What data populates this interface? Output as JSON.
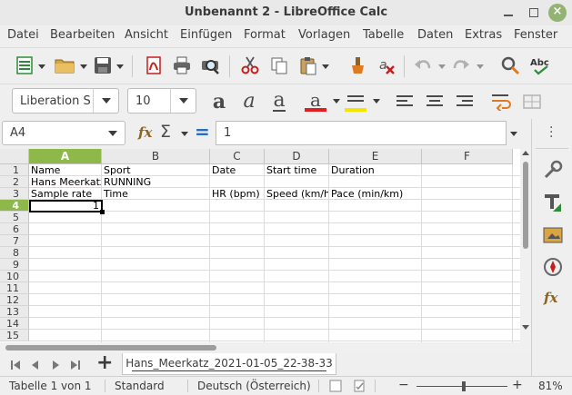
{
  "window": {
    "title": "Unbenannt 2 - LibreOffice Calc",
    "close_glyph": "×"
  },
  "menu": [
    "Datei",
    "Bearbeiten",
    "Ansicht",
    "Einfügen",
    "Format",
    "Vorlagen",
    "Tabelle",
    "Daten",
    "Extras",
    "Fenster"
  ],
  "toolbar": {
    "font_name": "Liberation S",
    "font_size": "10",
    "icons": [
      "new-spreadsheet-icon",
      "open-folder-icon",
      "save-icon",
      "export-pdf-icon",
      "print-icon",
      "print-preview-icon",
      "cut-icon",
      "copy-icon",
      "paste-icon",
      "clone-formatting-icon",
      "clear-formatting-icon",
      "undo-icon",
      "redo-icon",
      "find-replace-icon",
      "spelling-icon"
    ],
    "format_letters": {
      "bold": "a",
      "italic": "a",
      "underline": "a",
      "font_color": "a"
    },
    "font_color": "#e02020",
    "highlight_color": "#f5e400"
  },
  "formula_bar": {
    "name_box": "A4",
    "fx": "fx",
    "sigma": "Σ",
    "equals": "=",
    "content": "1"
  },
  "grid": {
    "columns": [
      "A",
      "B",
      "C",
      "D",
      "E",
      "F"
    ],
    "selected_column": "A",
    "rows": [
      "1",
      "2",
      "3",
      "4",
      "5",
      "6",
      "7",
      "8",
      "9",
      "10",
      "11",
      "12",
      "13",
      "14",
      "15"
    ],
    "selected_row": "4",
    "cells": {
      "A1": "Name",
      "B1": "Sport",
      "C1": "Date",
      "D1": "Start time",
      "E1": "Duration",
      "A2": "Hans Meerkatz",
      "B2": "RUNNING",
      "A3": "Sample rate",
      "B3": "Time",
      "C3": "HR (bpm)",
      "D3": "Speed (km/h)",
      "E3": "Pace (min/km)",
      "A4": "1"
    },
    "accent": "#8fb84b"
  },
  "sheet_tabs": {
    "add": "+",
    "active": "Hans_Meerkatz_2021-01-05_22-38-33"
  },
  "status": {
    "sheet": "Tabelle 1 von 1",
    "style": "Standard",
    "language": "Deutsch (Österreich)",
    "zoom_minus": "−",
    "zoom_plus": "+",
    "zoom": "81%"
  }
}
